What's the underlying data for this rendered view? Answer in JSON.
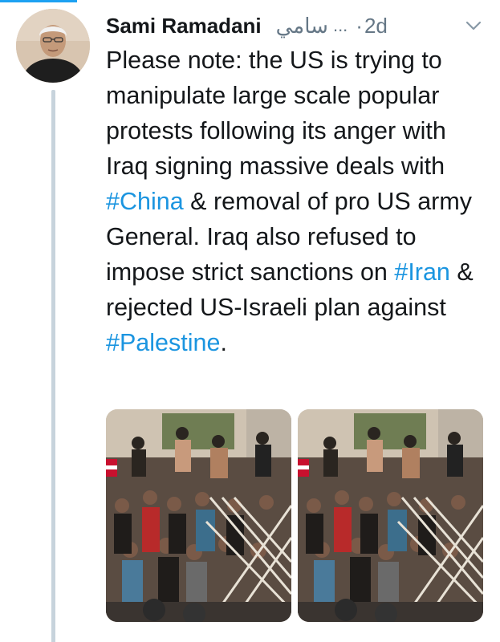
{
  "tweet": {
    "author_name": "Sami Ramadani",
    "author_handle": "سامي",
    "handle_ellipsis": "...",
    "separator": "·",
    "timestamp": "2d",
    "text_segments": [
      {
        "text": "Please note: the US is trying to manipulate large scale popular protests following its anger with Iraq signing massive deals with ",
        "hashtag": false
      },
      {
        "text": "#China",
        "hashtag": true
      },
      {
        "text": " & removal of pro US army General. Iraq also refused to impose strict sanctions on ",
        "hashtag": false
      },
      {
        "text": "#Iran",
        "hashtag": true
      },
      {
        "text": " & rejected US-Israeli plan against ",
        "hashtag": false
      },
      {
        "text": "#Palestine",
        "hashtag": true
      },
      {
        "text": ".",
        "hashtag": false
      }
    ],
    "media": [
      {
        "icon": "protest-crowd-photo"
      },
      {
        "icon": "protest-crowd-photo"
      }
    ]
  },
  "colors": {
    "accent": "#1da1f2",
    "hashtag": "#1b95e0",
    "muted": "#657786",
    "thread_line": "#c7d3dc"
  },
  "icons": {
    "menu": "chevron-down-icon",
    "avatar": "user-avatar"
  }
}
